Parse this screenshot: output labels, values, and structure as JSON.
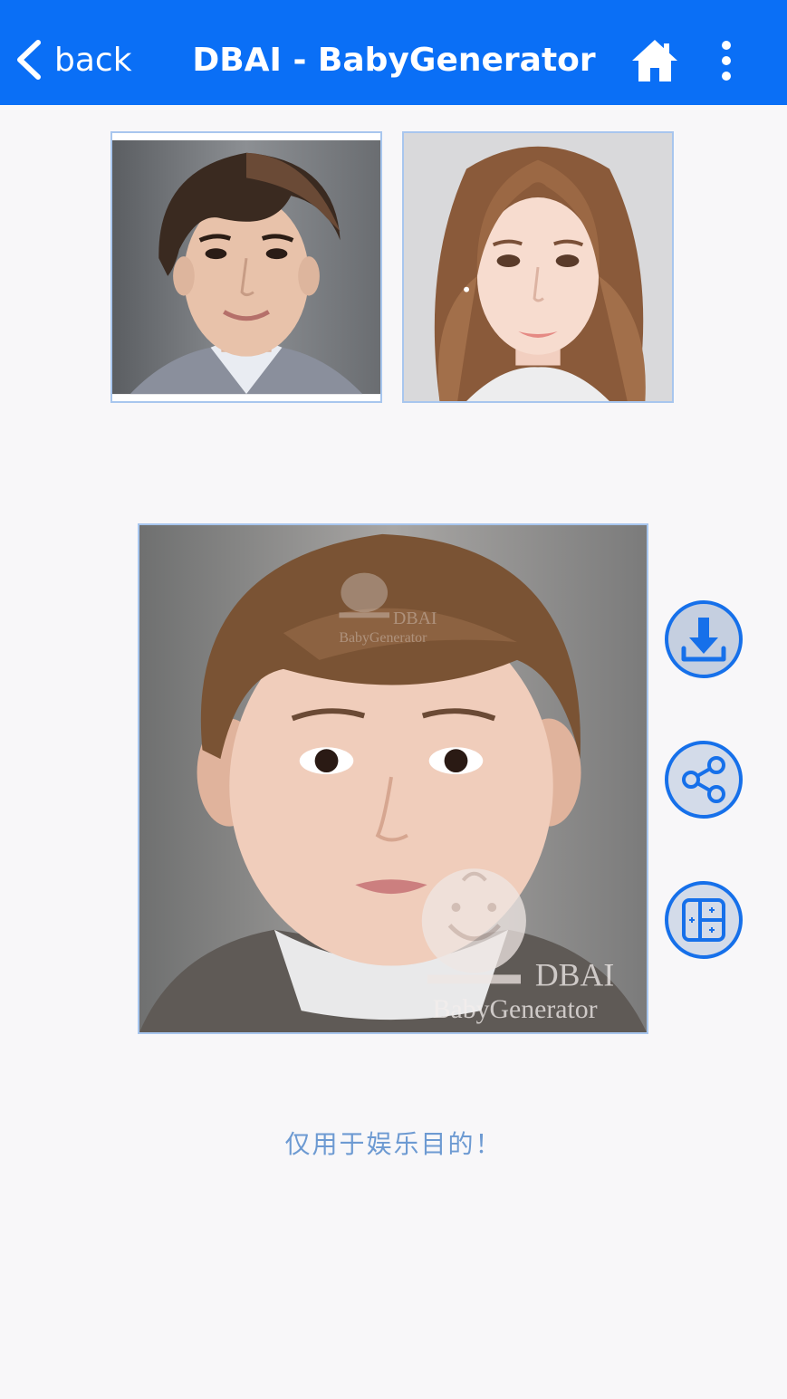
{
  "header": {
    "back_label": "back",
    "title": "DBAI - BabyGenerator",
    "background_color": "#0a6ff6",
    "home_icon": "home-icon",
    "menu_icon": "more-vertical-icon"
  },
  "parents": {
    "father_image": "father-portrait",
    "mother_image": "mother-portrait"
  },
  "result": {
    "child_image": "generated-child-portrait",
    "watermark_top": "DBAI",
    "watermark_top_sub": "BabyGenerator",
    "watermark_main": "DBAI",
    "watermark_main_sub": "BabyGenerator"
  },
  "actions": [
    {
      "icon": "download-icon"
    },
    {
      "icon": "share-icon"
    },
    {
      "icon": "layout-grid-icon"
    }
  ],
  "footer": {
    "disclaimer": "仅用于娱乐目的！",
    "disclaimer_color": "#6d9ad2"
  },
  "colors": {
    "accent": "#1670ea",
    "background": "#f8f7f9",
    "image_border": "#a8c6ee"
  }
}
